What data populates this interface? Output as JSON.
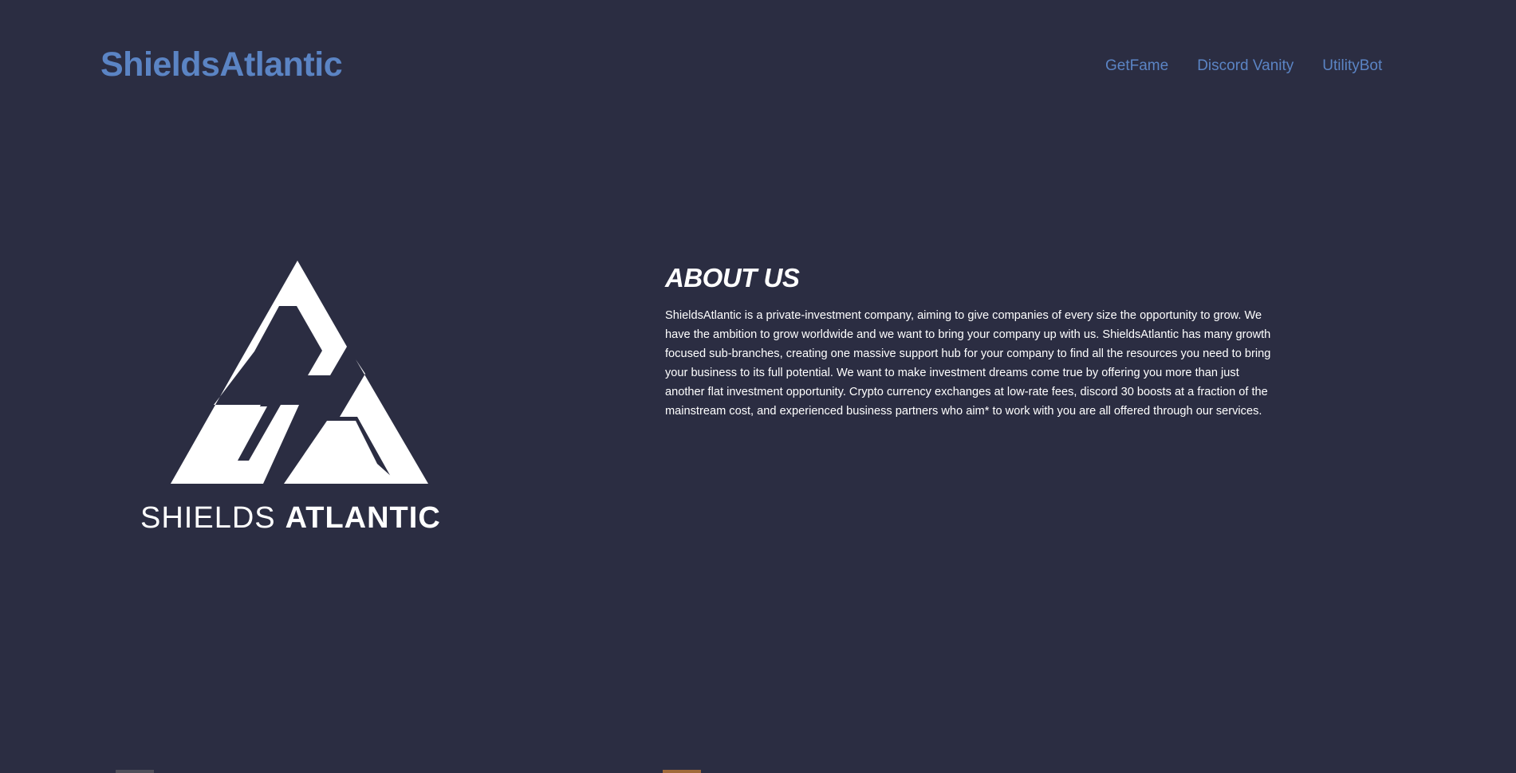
{
  "header": {
    "brand": "ShieldsAtlantic",
    "nav": [
      {
        "label": "GetFame"
      },
      {
        "label": "Discord Vanity"
      },
      {
        "label": "UtilityBot"
      }
    ]
  },
  "logo": {
    "text_light": "SHIELDS",
    "text_bold": "ATLANTIC"
  },
  "about": {
    "title": "ABOUT US",
    "body": "ShieldsAtlantic is a private-investment company, aiming to give companies of every size the opportunity to grow. We have the ambition to grow worldwide and we want to bring your company up with us. ShieldsAtlantic has many growth focused sub-branches, creating one massive support hub for your company to find all the resources you need to bring your business to its full potential. We want to make investment dreams come true by offering you more than just another flat investment opportunity. Crypto currency exchanges at low-rate fees, discord 30 boosts at a fraction of the mainstream cost, and experienced business partners who aim* to work with you are all offered through our services."
  },
  "colors": {
    "background": "#2b2d42",
    "accent": "#5b84c4",
    "text": "#ffffff"
  }
}
